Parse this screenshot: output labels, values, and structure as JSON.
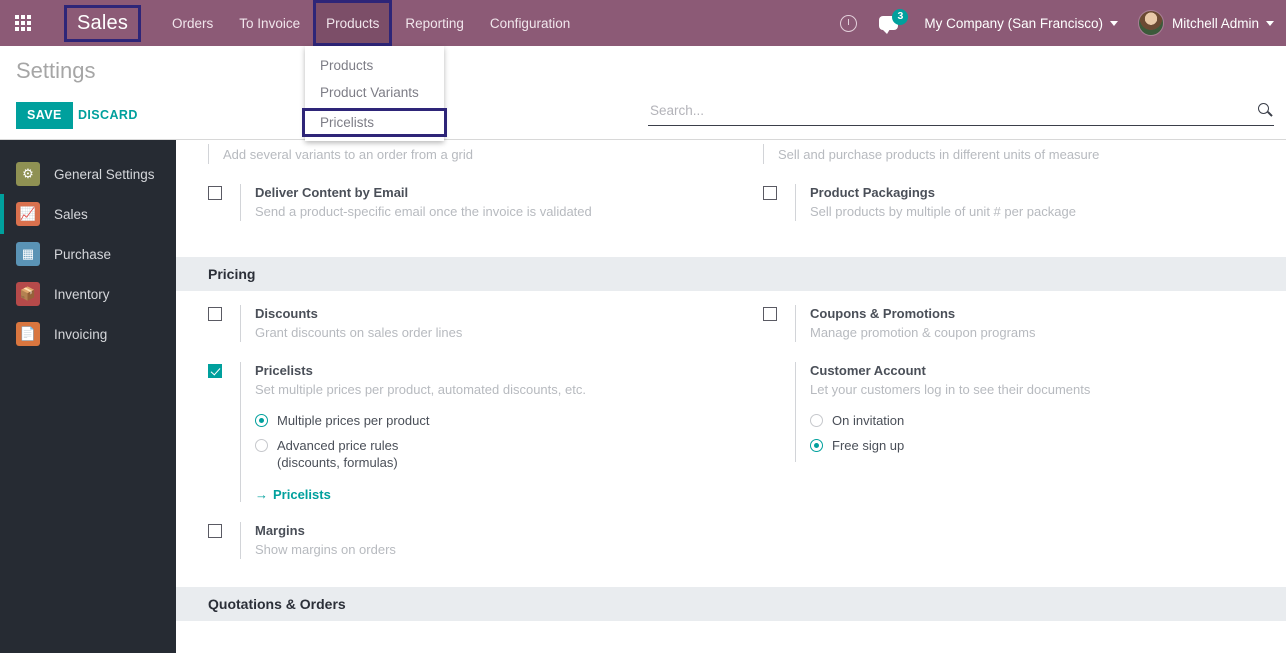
{
  "topbar": {
    "apps_icon": "apps-grid-icon",
    "brand": "Sales",
    "menu": [
      {
        "label": "Orders",
        "active": false
      },
      {
        "label": "To Invoice",
        "active": false
      },
      {
        "label": "Products",
        "active": true
      },
      {
        "label": "Reporting",
        "active": false
      },
      {
        "label": "Configuration",
        "active": false
      }
    ],
    "activity_icon": "clock-icon",
    "messages_icon": "chat-bubble-icon",
    "messages_count": "3",
    "company": "My Company (San Francisco)",
    "user": "Mitchell Admin"
  },
  "dropdown": {
    "items": [
      {
        "label": "Products",
        "highlighted": false
      },
      {
        "label": "Product Variants",
        "highlighted": false
      },
      {
        "label": "Pricelists",
        "highlighted": true
      }
    ]
  },
  "control": {
    "title": "Settings",
    "save_label": "SAVE",
    "discard_label": "DISCARD",
    "search_placeholder": "Search...",
    "search_value": "",
    "search_icon": "magnifier-icon"
  },
  "sidebar": {
    "items": [
      {
        "label": "General Settings",
        "icon": "gear-icon",
        "active": false
      },
      {
        "label": "Sales",
        "icon": "chart-icon",
        "active": true
      },
      {
        "label": "Purchase",
        "icon": "credit-card-icon",
        "active": false
      },
      {
        "label": "Inventory",
        "icon": "box-icon",
        "active": false
      },
      {
        "label": "Invoicing",
        "icon": "invoice-icon",
        "active": false
      }
    ]
  },
  "settings": {
    "top_partial": {
      "left_desc": "Add several variants to an order from a grid",
      "right_desc": "Sell and purchase products in different units of measure"
    },
    "product_rows": [
      {
        "title": "Deliver Content by Email",
        "desc": "Send a product-specific email once the invoice is validated",
        "checked": false
      },
      {
        "title": "Product Packagings",
        "desc": "Sell products by multiple of unit # per package",
        "checked": false
      }
    ],
    "pricing_header": "Pricing",
    "pricing_rows": [
      {
        "title": "Discounts",
        "desc": "Grant discounts on sales order lines",
        "checked": false
      },
      {
        "title": "Coupons & Promotions",
        "desc": "Manage promotion & coupon programs",
        "checked": false
      }
    ],
    "pricelists": {
      "title": "Pricelists",
      "desc": "Set multiple prices per product, automated discounts, etc.",
      "checked": true,
      "options": [
        {
          "label": "Multiple prices per product",
          "selected": true
        },
        {
          "label": "Advanced price rules",
          "label2": "(discounts, formulas)",
          "selected": false
        }
      ],
      "link": "Pricelists",
      "link_arrow": "→"
    },
    "customer_account": {
      "title": "Customer Account",
      "desc": "Let your customers log in to see their documents",
      "options": [
        {
          "label": "On invitation",
          "selected": false
        },
        {
          "label": "Free sign up",
          "selected": true
        }
      ]
    },
    "margins": {
      "title": "Margins",
      "desc": "Show margins on orders",
      "checked": false
    },
    "quotations_header": "Quotations & Orders"
  },
  "colors": {
    "topbar": "#8c5a76",
    "highlight": "#2e2578",
    "accent": "#00a09d",
    "sidebar": "#262b33",
    "section_band": "#e9ecef"
  }
}
